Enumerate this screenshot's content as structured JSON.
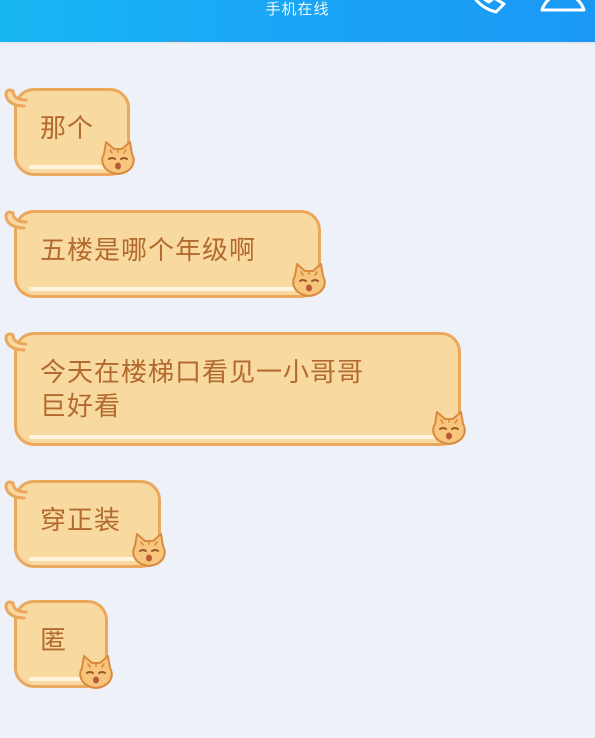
{
  "topbar": {
    "status": "手机在线",
    "phone_icon": "phone-icon",
    "profile_icon": "profile-icon"
  },
  "partial_header_text": "...",
  "messages": [
    {
      "text": "那个"
    },
    {
      "text": "五楼是哪个年级啊"
    },
    {
      "text": "今天在楼梯口看见一小哥哥\n巨好看"
    },
    {
      "text": "穿正装"
    },
    {
      "text": "匿"
    }
  ],
  "bubble_style": {
    "fill": "#f8d9a0",
    "border": "#eba85d",
    "text_color": "#b36a2e",
    "decoration": "cat-sticker-icon"
  },
  "colors": {
    "topbar": "#1aa8f6",
    "background": "#eef1f7"
  }
}
